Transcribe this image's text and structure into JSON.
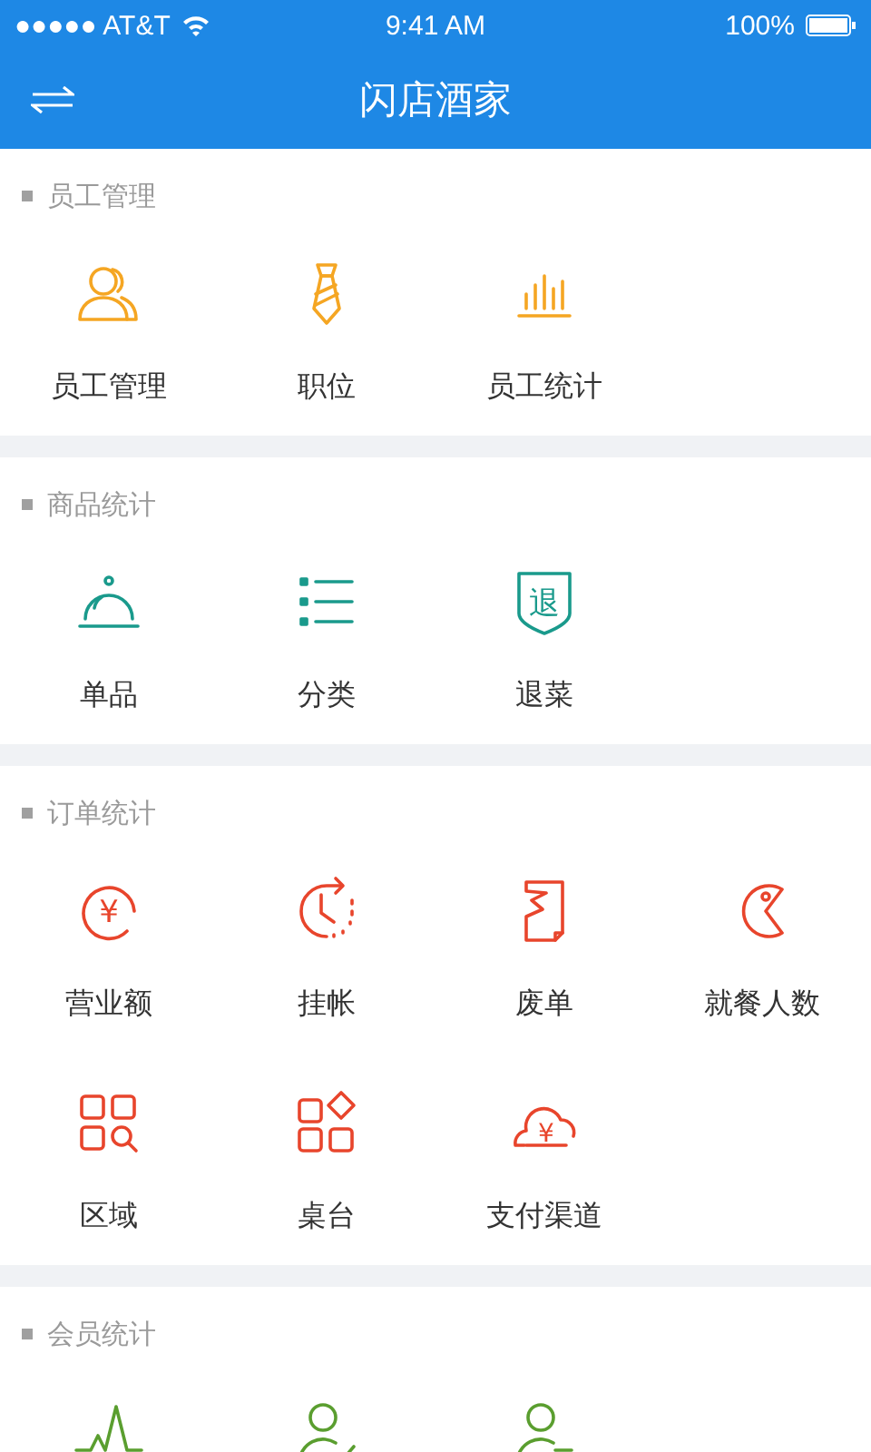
{
  "status_bar": {
    "carrier": "●●●●● AT&T",
    "time": "9:41 AM",
    "battery": "100%"
  },
  "nav_bar": {
    "title": "闪店酒家"
  },
  "sections": [
    {
      "title": "员工管理",
      "color": "#f5a623",
      "items": [
        {
          "kind": "tile",
          "label": "员工管理"
        },
        {
          "kind": "tile",
          "label": "职位"
        },
        {
          "kind": "tile",
          "label": "员工统计"
        }
      ]
    },
    {
      "title": "商品统计",
      "color": "#1a9a8c",
      "items": [
        {
          "kind": "tile",
          "label": "单品"
        },
        {
          "kind": "tile",
          "label": "分类"
        },
        {
          "kind": "tile",
          "label": "退菜",
          "icon_text": "退"
        }
      ]
    },
    {
      "title": "订单统计",
      "color": "#e8452c",
      "items": [
        {
          "kind": "tile",
          "label": "营业额",
          "icon_text": "¥"
        },
        {
          "kind": "tile",
          "label": "挂帐"
        },
        {
          "kind": "tile",
          "label": "废单"
        },
        {
          "kind": "tile",
          "label": "就餐人数"
        },
        {
          "kind": "tile",
          "label": "区域"
        },
        {
          "kind": "tile",
          "label": "桌台"
        },
        {
          "kind": "tile",
          "label": "支付渠道",
          "icon_text": "¥"
        }
      ]
    },
    {
      "title": "会员统计",
      "color": "#5a9e2f",
      "items": [
        {
          "kind": "tile"
        },
        {
          "kind": "tile"
        },
        {
          "kind": "tile"
        }
      ]
    }
  ]
}
